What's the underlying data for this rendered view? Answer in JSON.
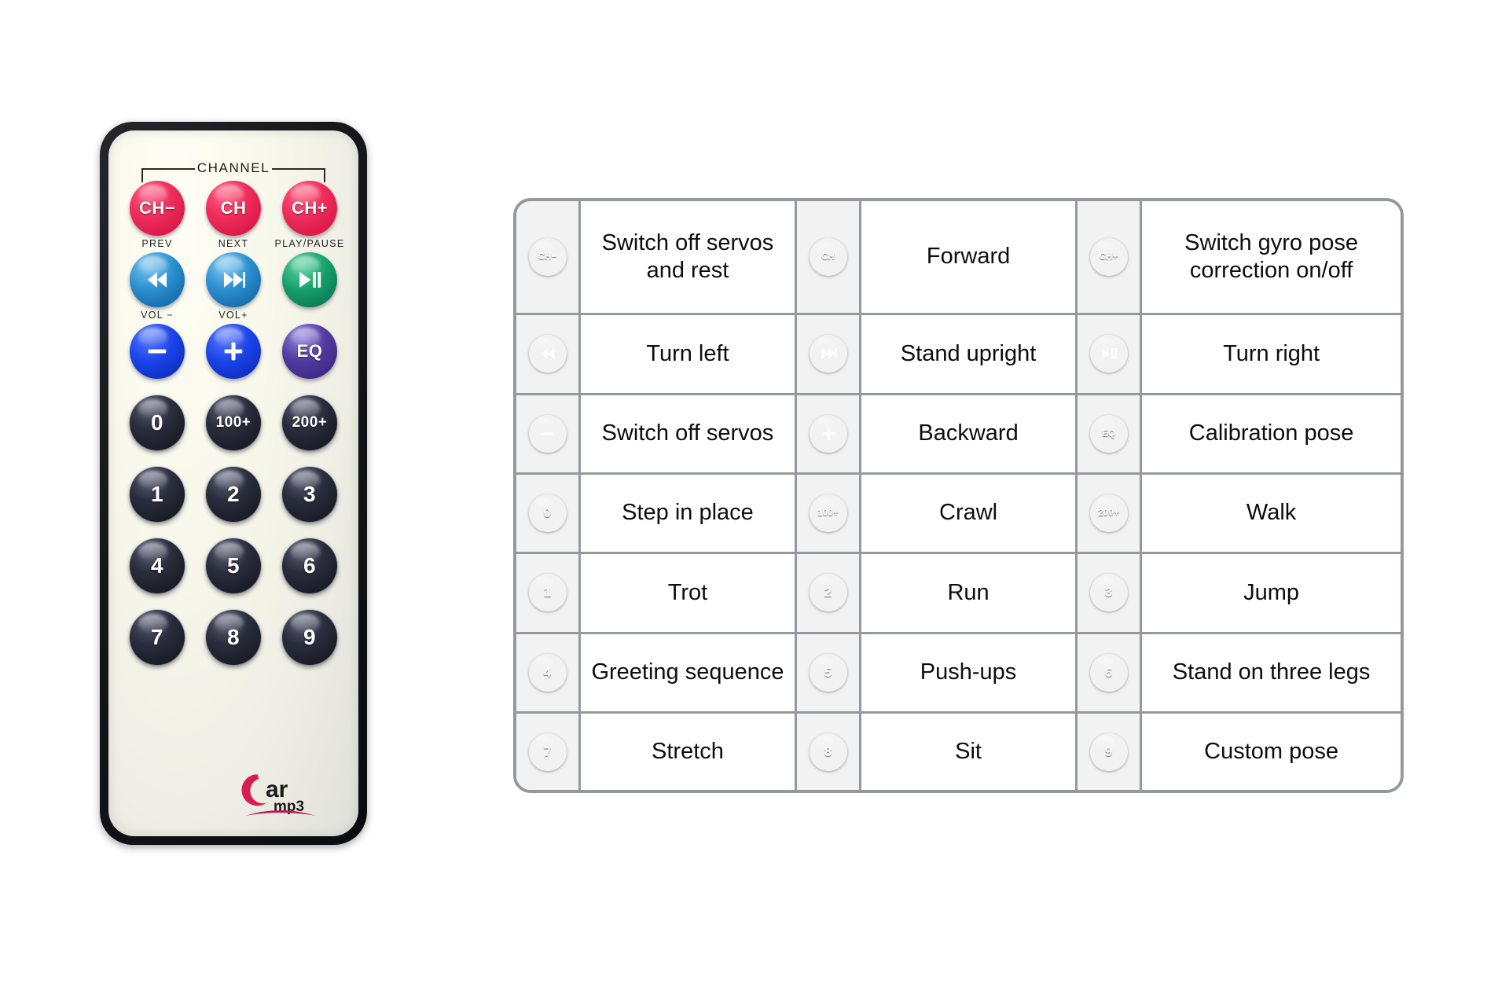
{
  "remote": {
    "brand": {
      "word": "ar",
      "sub": "mp3",
      "cap": "C",
      "color": "#d81b50"
    },
    "channel_label": "CHANNEL",
    "rows": [
      {
        "buttons": [
          {
            "label": "CH−",
            "sub": "PREV",
            "color": "red",
            "kind": "text",
            "name": "remote-button-ch-minus"
          },
          {
            "label": "CH",
            "sub": "NEXT",
            "color": "red",
            "kind": "text",
            "name": "remote-button-ch"
          },
          {
            "label": "CH+",
            "sub": "PLAY/PAUSE",
            "color": "red",
            "kind": "text",
            "name": "remote-button-ch-plus"
          }
        ]
      },
      {
        "buttons": [
          {
            "label": "",
            "sub": "VOL −",
            "color": "blue",
            "kind": "prev",
            "name": "remote-button-prev-track"
          },
          {
            "label": "",
            "sub": "VOL+",
            "color": "blue",
            "kind": "next",
            "name": "remote-button-next-track"
          },
          {
            "label": "",
            "sub": "",
            "color": "green",
            "kind": "playpause",
            "name": "remote-button-play-pause"
          }
        ]
      },
      {
        "buttons": [
          {
            "label": "−",
            "sub": "",
            "color": "royal",
            "kind": "minus",
            "name": "remote-button-minus"
          },
          {
            "label": "+",
            "sub": "",
            "color": "royal",
            "kind": "plus",
            "name": "remote-button-plus"
          },
          {
            "label": "EQ",
            "sub": "",
            "color": "purple",
            "kind": "text",
            "name": "remote-button-eq"
          }
        ]
      },
      {
        "buttons": [
          {
            "label": "0",
            "sub": "",
            "color": "black",
            "kind": "num",
            "name": "remote-button-0"
          },
          {
            "label": "100+",
            "sub": "",
            "color": "black",
            "kind": "small",
            "name": "remote-button-100-plus"
          },
          {
            "label": "200+",
            "sub": "",
            "color": "black",
            "kind": "small",
            "name": "remote-button-200-plus"
          }
        ]
      },
      {
        "buttons": [
          {
            "label": "1",
            "sub": "",
            "color": "black",
            "kind": "num",
            "name": "remote-button-1"
          },
          {
            "label": "2",
            "sub": "",
            "color": "black",
            "kind": "num",
            "name": "remote-button-2"
          },
          {
            "label": "3",
            "sub": "",
            "color": "black",
            "kind": "num",
            "name": "remote-button-3"
          }
        ]
      },
      {
        "buttons": [
          {
            "label": "4",
            "sub": "",
            "color": "black",
            "kind": "num",
            "name": "remote-button-4"
          },
          {
            "label": "5",
            "sub": "",
            "color": "black",
            "kind": "num",
            "name": "remote-button-5"
          },
          {
            "label": "6",
            "sub": "",
            "color": "black",
            "kind": "num",
            "name": "remote-button-6"
          }
        ]
      },
      {
        "buttons": [
          {
            "label": "7",
            "sub": "",
            "color": "black",
            "kind": "num",
            "name": "remote-button-7"
          },
          {
            "label": "8",
            "sub": "",
            "color": "black",
            "kind": "num",
            "name": "remote-button-8"
          },
          {
            "label": "9",
            "sub": "",
            "color": "black",
            "kind": "num",
            "name": "remote-button-9"
          }
        ]
      }
    ]
  },
  "legend": {
    "rows": [
      [
        {
          "key": "CH−",
          "color": "red",
          "kind": "tiny",
          "desc": "Switch off servos and rest",
          "icon_name": "legend-icon-ch-minus"
        },
        {
          "key": "CH",
          "color": "red",
          "kind": "tiny",
          "desc": "Forward",
          "icon_name": "legend-icon-ch"
        },
        {
          "key": "CH+",
          "color": "red",
          "kind": "tiny",
          "desc": "Switch gyro pose correction on/off",
          "icon_name": "legend-icon-ch-plus"
        }
      ],
      [
        {
          "key": "",
          "color": "blue",
          "kind": "prev",
          "desc": "Turn left",
          "icon_name": "legend-icon-prev-track"
        },
        {
          "key": "",
          "color": "blue",
          "kind": "next",
          "desc": "Stand upright",
          "icon_name": "legend-icon-next-track"
        },
        {
          "key": "",
          "color": "green",
          "kind": "playpause",
          "desc": "Turn right",
          "icon_name": "legend-icon-play-pause"
        }
      ],
      [
        {
          "key": "−",
          "color": "royal",
          "kind": "minus",
          "desc": "Switch off servos",
          "icon_name": "legend-icon-minus"
        },
        {
          "key": "+",
          "color": "royal",
          "kind": "plus",
          "desc": "Backward",
          "icon_name": "legend-icon-plus"
        },
        {
          "key": "EQ",
          "color": "purple",
          "kind": "tiny",
          "desc": "Calibration pose",
          "icon_name": "legend-icon-eq"
        }
      ],
      [
        {
          "key": "0",
          "color": "black",
          "kind": "big",
          "desc": "Step in place",
          "icon_name": "legend-icon-0"
        },
        {
          "key": "100+",
          "color": "black",
          "kind": "tiny",
          "desc": "Crawl",
          "icon_name": "legend-icon-100-plus"
        },
        {
          "key": "200+",
          "color": "black",
          "kind": "tiny",
          "desc": "Walk",
          "icon_name": "legend-icon-200-plus"
        }
      ],
      [
        {
          "key": "1",
          "color": "black",
          "kind": "big",
          "desc": "Trot",
          "icon_name": "legend-icon-1"
        },
        {
          "key": "2",
          "color": "black",
          "kind": "big",
          "desc": "Run",
          "icon_name": "legend-icon-2"
        },
        {
          "key": "3",
          "color": "black",
          "kind": "big",
          "desc": "Jump",
          "icon_name": "legend-icon-3"
        }
      ],
      [
        {
          "key": "4",
          "color": "black",
          "kind": "big",
          "desc": "Greeting sequence",
          "icon_name": "legend-icon-4"
        },
        {
          "key": "5",
          "color": "black",
          "kind": "big",
          "desc": "Push-ups",
          "icon_name": "legend-icon-5"
        },
        {
          "key": "6",
          "color": "black",
          "kind": "big",
          "desc": "Stand on three legs",
          "icon_name": "legend-icon-6"
        }
      ],
      [
        {
          "key": "7",
          "color": "black",
          "kind": "big",
          "desc": "Stretch",
          "icon_name": "legend-icon-7"
        },
        {
          "key": "8",
          "color": "black",
          "kind": "big",
          "desc": "Sit",
          "icon_name": "legend-icon-8"
        },
        {
          "key": "9",
          "color": "black",
          "kind": "big",
          "desc": "Custom pose",
          "icon_name": "legend-icon-9"
        }
      ]
    ]
  },
  "colors": {
    "red": "#e8234f",
    "blue": "#1f7fc4",
    "green": "#0f9b68",
    "royal": "#1a43e8",
    "purple": "#51399f",
    "black": "#1b1d28",
    "table_border": "#9499a0",
    "icon_cell_bg": "#f2f2f2",
    "brand": "#d81b50"
  }
}
